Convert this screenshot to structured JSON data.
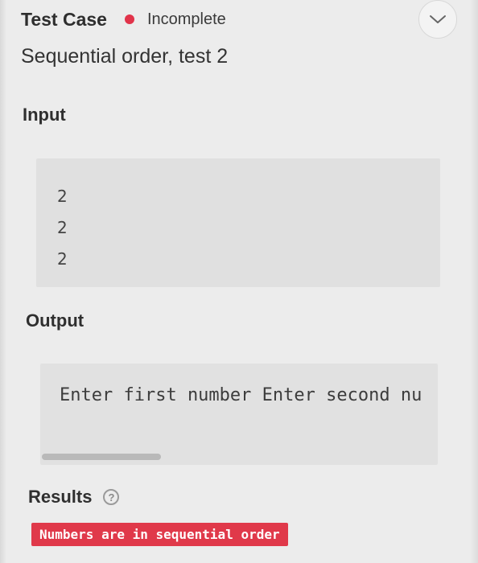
{
  "header": {
    "title": "Test Case",
    "status": "Incomplete",
    "status_color": "#e1334a",
    "toggle_icon": "chevron-down-icon"
  },
  "test": {
    "name": "Sequential order, test 2"
  },
  "input": {
    "label": "Input",
    "lines": [
      "2",
      "2",
      "2"
    ]
  },
  "output": {
    "label": "Output",
    "text": "Enter first number Enter second nu",
    "scroll_fraction": 0.3
  },
  "results": {
    "label": "Results",
    "help_icon": "question-icon",
    "badge": "Numbers are in sequential order",
    "badge_color": "#e0394a"
  }
}
